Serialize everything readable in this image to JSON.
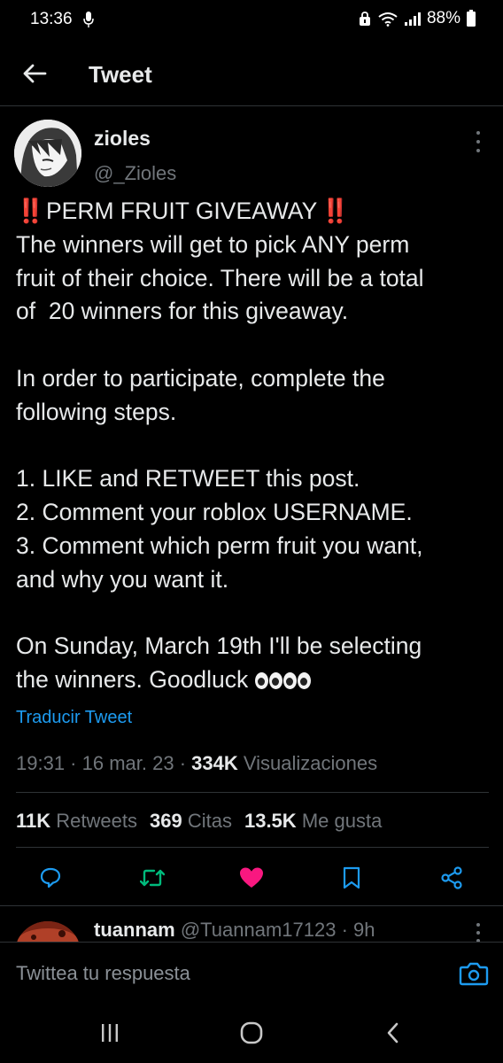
{
  "status_bar": {
    "time": "13:36",
    "battery": "88%"
  },
  "header": {
    "title": "Tweet"
  },
  "tweet": {
    "author_name": "zioles",
    "author_handle": "@_Zioles",
    "title_text": "PERM FRUIT GIVEAWAY",
    "title_emoji": "‼️",
    "body_lines": [
      "The winners will get to pick ANY perm",
      "fruit of their choice. There will be a total",
      "of  20 winners for this giveaway.",
      "",
      "In order to participate, complete the",
      "following steps.",
      "",
      "1. LIKE and RETWEET this post.",
      "2. Comment your roblox USERNAME.",
      "3. Comment which perm fruit you want,",
      "and why you want it.",
      "",
      "On Sunday, March 19th I'll be selecting"
    ],
    "last_line": "the winners. Goodluck",
    "translate": "Traducir Tweet",
    "time": "19:31",
    "date": "16 mar. 23",
    "views_count": "334K",
    "views_label": "Visualizaciones",
    "retweets_count": "11K",
    "retweets_label": "Retweets",
    "quotes_count": "369",
    "quotes_label": "Citas",
    "likes_count": "13.5K",
    "likes_label": "Me gusta"
  },
  "reply": {
    "author_name": "tuannam",
    "author_handle": "@Tuannam17123",
    "time": "9h"
  },
  "compose": {
    "placeholder": "Twittea tu respuesta"
  },
  "colors": {
    "accent": "#1d9bf0",
    "retweet": "#00ba7c",
    "like": "#f91880",
    "alert": "#f4212e"
  }
}
